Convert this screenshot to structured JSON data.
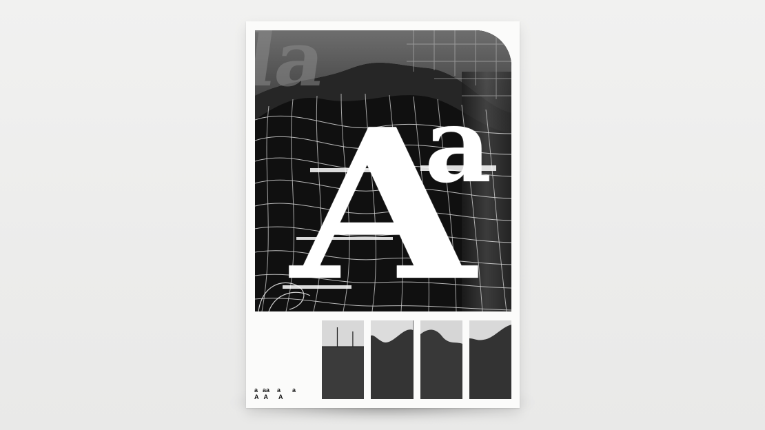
{
  "poster": {
    "glyph_upper": "A",
    "glyph_lower": "a",
    "background_letters": "la",
    "specimen_row1": [
      "a",
      "aa",
      "a",
      "a"
    ],
    "specimen_row2": [
      "A",
      "A",
      "A"
    ]
  },
  "colors": {
    "backdrop": "#eeeeed",
    "paper": "#fbfbfa",
    "ink": "#0e0e0e",
    "glyph": "#ffffff",
    "grid": "#d9d9d9"
  },
  "strips": {
    "count": 4
  }
}
